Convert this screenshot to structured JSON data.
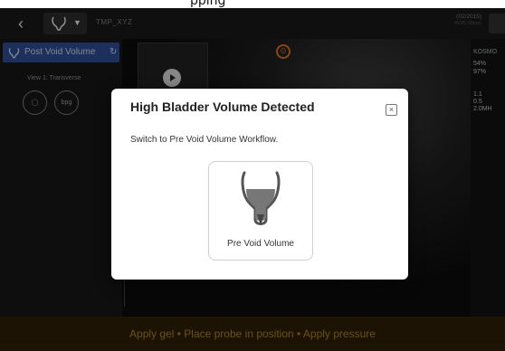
{
  "top_strip_text": "pping",
  "topbar": {
    "back_icon": "chevron-left-icon",
    "preset_icon": "bladder-icon",
    "file_name": "TMP_XYZ",
    "device_id": "(02/2015)",
    "device_status": "ROI5 50mm"
  },
  "sidebar": {
    "workflow_label": "Post Void Volume",
    "view_label": "View 1: Transverse",
    "mode_icon_1": "probe",
    "mode_icon_2": "bpg"
  },
  "right_panel": {
    "probe": "KOSMO",
    "lines": [
      "54%",
      "97%",
      "",
      "1.1",
      "0.5",
      "2.0MH"
    ]
  },
  "orientation_marker": "Θ",
  "bottom_instruction": "Apply gel • Place probe in position • Apply pressure",
  "dialog": {
    "title": "High Bladder Volume Detected",
    "message": "Switch to Pre Void Volume Workflow.",
    "option_label": "Pre Void Volume",
    "close_symbol": "×"
  },
  "colors": {
    "workflow_tab": "#2c4a8c",
    "bottom_bar": "#2b1e08",
    "bottom_text": "#a47c2c",
    "bladder_fill": "#777777"
  }
}
